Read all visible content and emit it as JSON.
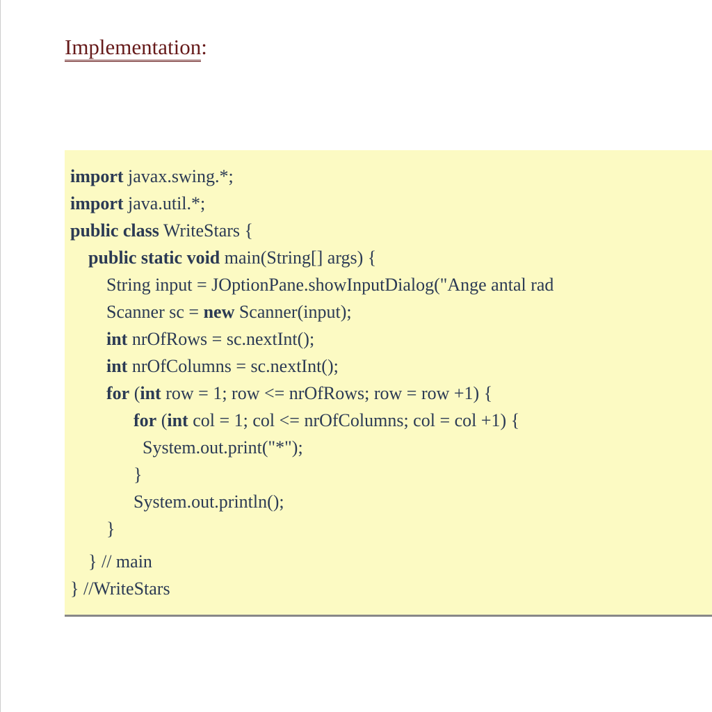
{
  "heading": {
    "underlined": "Implementation",
    "colon": ":"
  },
  "code": {
    "lines": [
      {
        "indent": 0,
        "parts": [
          {
            "t": "import",
            "kw": true
          },
          {
            "t": " javax.swing.*;"
          }
        ]
      },
      {
        "indent": 0,
        "parts": [
          {
            "t": "import",
            "kw": true
          },
          {
            "t": " java.util.*;"
          }
        ]
      },
      {
        "indent": 0,
        "parts": [
          {
            "t": "public class",
            "kw": true
          },
          {
            "t": " WriteStars {"
          }
        ]
      },
      {
        "indent": 1,
        "parts": [
          {
            "t": "public static void",
            "kw": true
          },
          {
            "t": " main(String[] args) {"
          }
        ]
      },
      {
        "indent": 2,
        "parts": [
          {
            "t": "String input = JOptionPane.showInputDialog(\"Ange antal rad"
          }
        ]
      },
      {
        "indent": 2,
        "parts": [
          {
            "t": "Scanner sc = "
          },
          {
            "t": "new",
            "kw": true
          },
          {
            "t": " Scanner(input);"
          }
        ]
      },
      {
        "indent": 2,
        "parts": [
          {
            "t": "int",
            "kw": true
          },
          {
            "t": " nrOfRows = sc.nextInt();"
          }
        ]
      },
      {
        "indent": 2,
        "parts": [
          {
            "t": "int",
            "kw": true
          },
          {
            "t": " nrOfColumns = sc.nextInt();"
          }
        ]
      },
      {
        "indent": 2,
        "parts": [
          {
            "t": "for",
            "kw": true
          },
          {
            "t": " ("
          },
          {
            "t": "int",
            "kw": true
          },
          {
            "t": " row = 1; row <= nrOfRows; row = row +1) {"
          }
        ]
      },
      {
        "indent": 3.5,
        "parts": [
          {
            "t": "for",
            "kw": true
          },
          {
            "t": " ("
          },
          {
            "t": "int",
            "kw": true
          },
          {
            "t": " col = 1; col <= nrOfColumns; col = col +1) {"
          }
        ]
      },
      {
        "indent": 4,
        "parts": [
          {
            "t": "System.out.print(\"*\");"
          }
        ]
      },
      {
        "indent": 3.5,
        "parts": [
          {
            "t": "}"
          }
        ]
      },
      {
        "indent": 3.5,
        "parts": [
          {
            "t": "System.out.println();"
          }
        ]
      },
      {
        "indent": 2,
        "parts": [
          {
            "t": "}"
          }
        ]
      },
      {
        "indent": 1,
        "parts": [
          {
            "t": "} // main"
          }
        ],
        "spaceBefore": true
      },
      {
        "indent": 0,
        "parts": [
          {
            "t": "} //WriteStars"
          }
        ]
      }
    ]
  }
}
